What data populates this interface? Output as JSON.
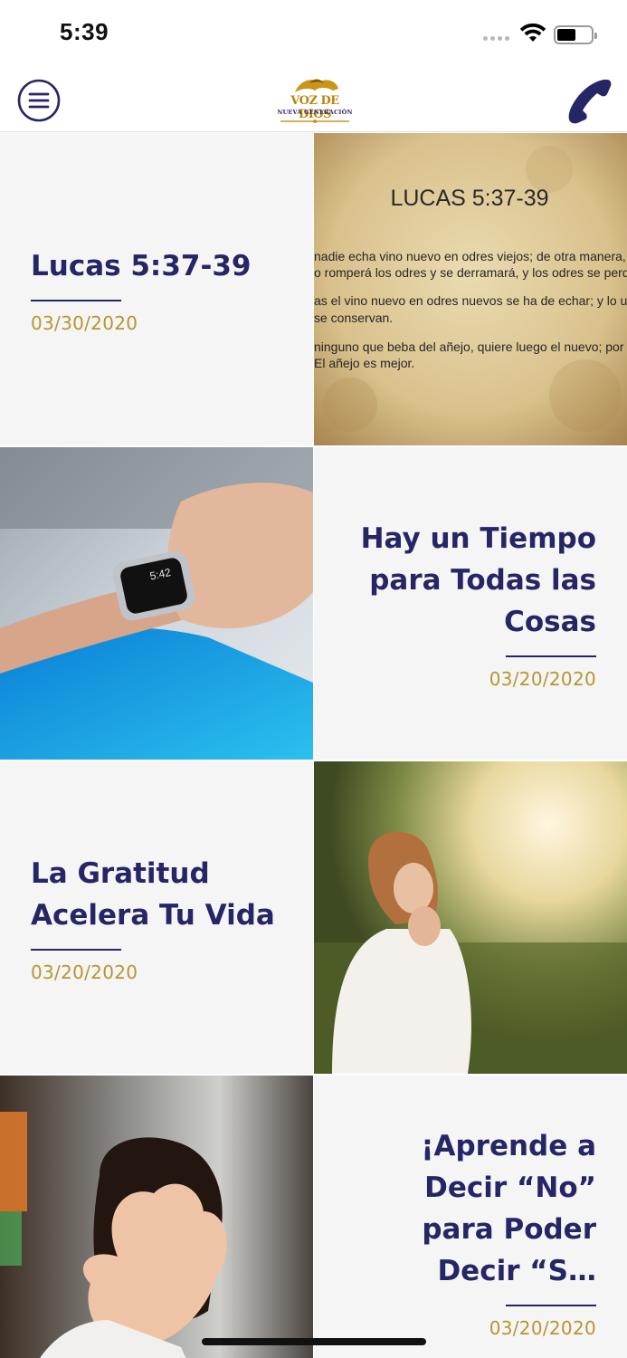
{
  "status_bar": {
    "time": "5:39"
  },
  "header": {
    "logo_text": "VOZ DE DIOS",
    "logo_subtext": "NUEVA GENERACIÓN",
    "menu_icon": "menu-icon",
    "phone_icon": "phone-icon"
  },
  "posts": [
    {
      "title": "Lucas 5:37-39",
      "date": "03/30/2020",
      "image": {
        "heading": "LUCAS 5:37-39",
        "lines": [
          "nadie echa vino nuevo en odres viejos; de otra manera, el v",
          "o romperá los odres y se derramará, y los odres se perder",
          "as el vino nuevo en odres nuevos se ha de echar; y lo uno",
          "se conservan.",
          " ninguno que beba del añejo, quiere luego el nuevo; por",
          "El añejo es mejor."
        ]
      }
    },
    {
      "title": "Hay un Tiempo para Todas las Cosas",
      "date": "03/20/2020",
      "image": {
        "watch_time": "5:42"
      }
    },
    {
      "title": "La Gratitud Acelera Tu Vida",
      "date": "03/20/2020"
    },
    {
      "title": "¡Aprende a Decir “No” para Poder Decir “S…",
      "date": "03/20/2020"
    }
  ],
  "colors": {
    "title": "#262565",
    "date": "#b8952f",
    "card_bg": "#f5f5f5"
  }
}
